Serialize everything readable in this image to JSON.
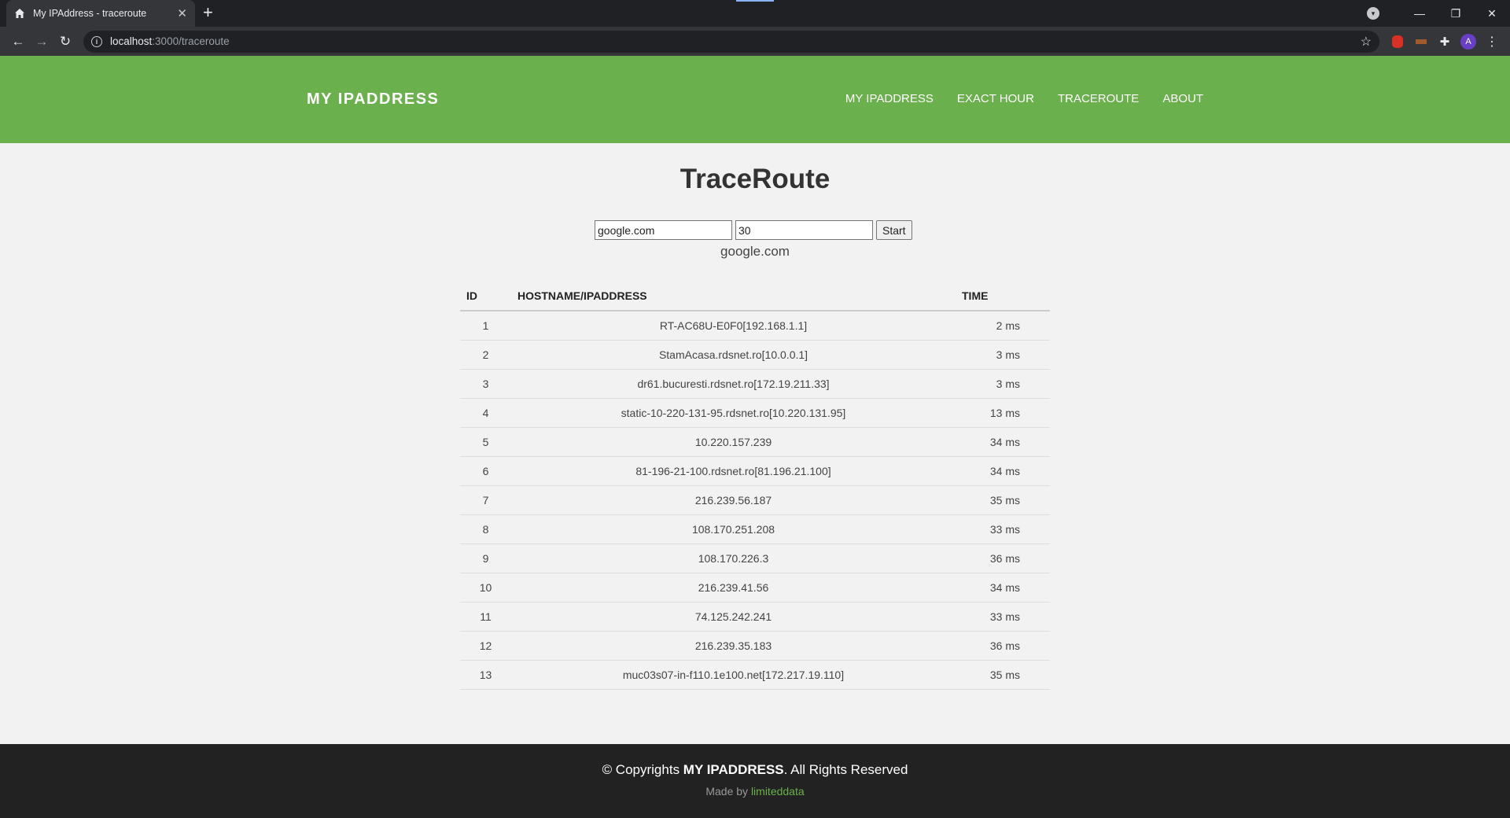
{
  "browser": {
    "tab_title": "My IPAddress - traceroute",
    "url_host": "localhost",
    "url_path": ":3000/traceroute",
    "profile_initial": "A"
  },
  "site": {
    "brand": "MY IPADDRESS",
    "nav": [
      "MY IPADDRESS",
      "EXACT HOUR",
      "TRACEROUTE",
      "ABOUT"
    ]
  },
  "main": {
    "title": "TraceRoute",
    "host_input_value": "google.com",
    "hops_input_value": "30",
    "start_label": "Start",
    "target_display": "google.com",
    "columns": [
      "ID",
      "HOSTNAME/IPADDRESS",
      "TIME"
    ],
    "rows": [
      {
        "id": "1",
        "host": "RT-AC68U-E0F0[192.168.1.1]",
        "time": "2 ms"
      },
      {
        "id": "2",
        "host": "StamAcasa.rdsnet.ro[10.0.0.1]",
        "time": "3 ms"
      },
      {
        "id": "3",
        "host": "dr61.bucuresti.rdsnet.ro[172.19.211.33]",
        "time": "3 ms"
      },
      {
        "id": "4",
        "host": "static-10-220-131-95.rdsnet.ro[10.220.131.95]",
        "time": "13 ms"
      },
      {
        "id": "5",
        "host": "10.220.157.239",
        "time": "34 ms"
      },
      {
        "id": "6",
        "host": "81-196-21-100.rdsnet.ro[81.196.21.100]",
        "time": "34 ms"
      },
      {
        "id": "7",
        "host": "216.239.56.187",
        "time": "35 ms"
      },
      {
        "id": "8",
        "host": "108.170.251.208",
        "time": "33 ms"
      },
      {
        "id": "9",
        "host": "108.170.226.3",
        "time": "36 ms"
      },
      {
        "id": "10",
        "host": "216.239.41.56",
        "time": "34 ms"
      },
      {
        "id": "11",
        "host": "74.125.242.241",
        "time": "33 ms"
      },
      {
        "id": "12",
        "host": "216.239.35.183",
        "time": "36 ms"
      },
      {
        "id": "13",
        "host": "muc03s07-in-f110.1e100.net[172.217.19.110]",
        "time": "35 ms"
      }
    ]
  },
  "footer": {
    "copy_prefix": "© Copyrights ",
    "copy_brand": "MY IPADDRESS",
    "copy_suffix": ". All Rights Reserved",
    "made_by": "Made by ",
    "author": "limiteddata"
  },
  "colors": {
    "header_green": "#6ab04c",
    "footer_bg": "#222222",
    "page_bg": "#f2f2f2"
  }
}
